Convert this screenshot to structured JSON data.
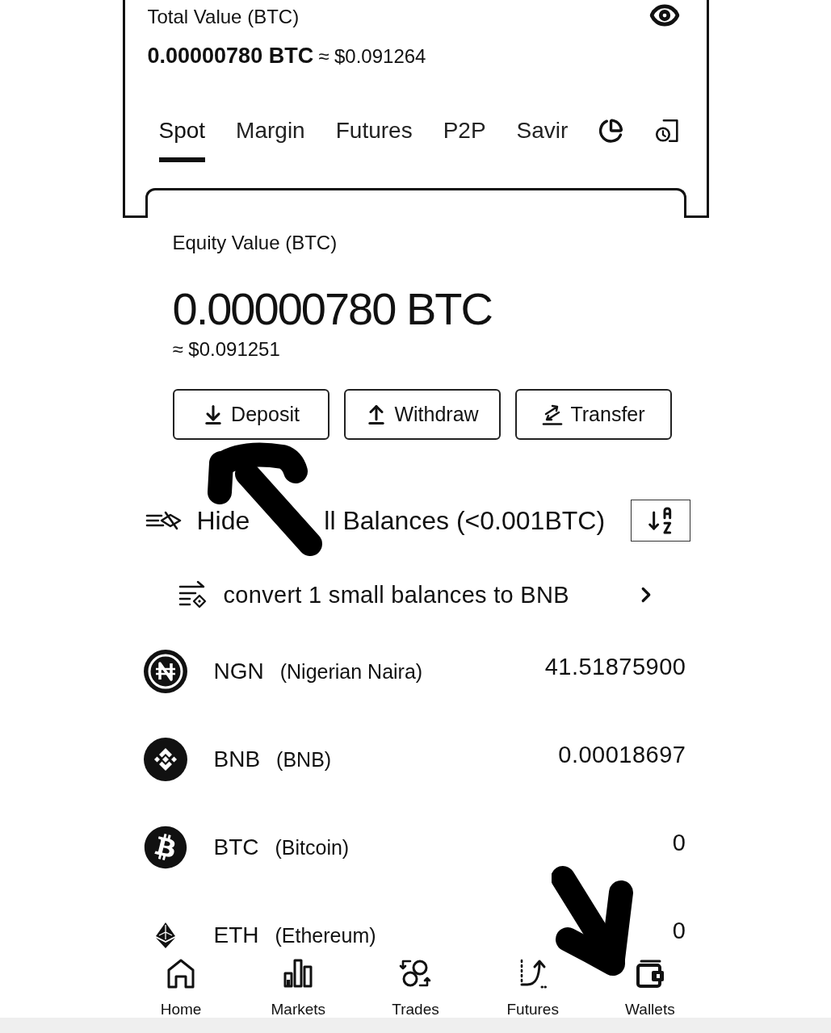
{
  "summary": {
    "title": "Total Value (BTC)",
    "amount": "0.00000780 BTC",
    "fiat": "≈ $0.091264"
  },
  "tabs": [
    {
      "label": "Spot",
      "selected": true
    },
    {
      "label": "Margin",
      "selected": false
    },
    {
      "label": "Futures",
      "selected": false
    },
    {
      "label": "P2P",
      "selected": false
    },
    {
      "label": "Savir",
      "selected": false
    }
  ],
  "equity": {
    "label": "Equity Value (BTC)",
    "amount": "0.00000780 BTC",
    "fiat": "≈ $0.091251"
  },
  "actions": [
    {
      "kind": "deposit",
      "label": "Deposit"
    },
    {
      "kind": "withdraw",
      "label": "Withdraw"
    },
    {
      "kind": "transfer",
      "label": "Transfer"
    }
  ],
  "small_balances": {
    "visible_text": [
      "Hide",
      "ll Balances (<0.001BTC)"
    ]
  },
  "convert": {
    "label": "convert 1 small balances to BNB"
  },
  "assets": [
    {
      "kind": "ngn",
      "ticker": "NGN",
      "name": "(Nigerian Naira)",
      "balance": "41.51875900"
    },
    {
      "kind": "bnb",
      "ticker": "BNB",
      "name": "(BNB)",
      "balance": "0.00018697"
    },
    {
      "kind": "btc",
      "ticker": "BTC",
      "name": "(Bitcoin)",
      "balance": "0"
    },
    {
      "kind": "eth",
      "ticker": "ETH",
      "name": "(Ethereum)",
      "balance": "0"
    }
  ],
  "bottom_nav": [
    {
      "kind": "home",
      "label": "Home"
    },
    {
      "kind": "markets",
      "label": "Markets"
    },
    {
      "kind": "trades",
      "label": "Trades"
    },
    {
      "kind": "futures",
      "label": "Futures"
    },
    {
      "kind": "wallets",
      "label": "Wallets"
    }
  ],
  "hand_drawn_arrows": [
    {
      "kind": "up_left"
    },
    {
      "kind": "down_right"
    }
  ]
}
